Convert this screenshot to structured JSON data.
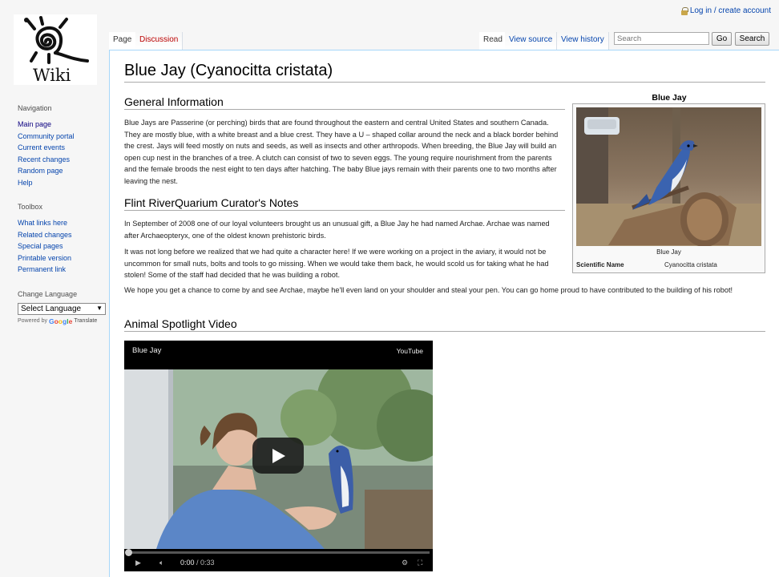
{
  "personal": {
    "login_label": "Log in / create account"
  },
  "logo": {
    "wordmark": "Wiki"
  },
  "sidebar": {
    "navigation": {
      "heading": "Navigation",
      "items": [
        "Main page",
        "Community portal",
        "Current events",
        "Recent changes",
        "Random page",
        "Help"
      ]
    },
    "toolbox": {
      "heading": "Toolbox",
      "items": [
        "What links here",
        "Related changes",
        "Special pages",
        "Printable version",
        "Permanent link"
      ]
    },
    "language": {
      "heading": "Change Language",
      "select_value": "Select Language",
      "powered_by": "Powered by",
      "google_letters": [
        "G",
        "o",
        "o",
        "g",
        "l",
        "e"
      ],
      "translate": "Translate"
    }
  },
  "tabs": {
    "page": "Page",
    "discussion": "Discussion",
    "read": "Read",
    "view_source": "View source",
    "view_history": "View history"
  },
  "search": {
    "placeholder": "Search",
    "go_label": "Go",
    "search_label": "Search"
  },
  "article": {
    "title": "Blue Jay (Cyanocitta cristata)",
    "sections": [
      {
        "heading": "General Information",
        "paragraphs": [
          "Blue Jays are Passerine (or perching) birds that are found throughout the eastern and central United States and southern Canada. They are mostly blue, with a white breast and a blue crest. They have a U – shaped collar around the neck and a black border behind the crest. Jays will feed mostly on nuts and seeds, as well as insects and other arthropods. When breeding, the Blue Jay will build an open cup nest in the branches of a tree. A clutch can consist of two to seven eggs. The young require nourishment from the parents and the female broods the nest eight to ten days after hatching. The baby Blue jays remain with their parents one to two months after leaving the nest."
        ]
      },
      {
        "heading": "Flint RiverQuarium Curator's Notes",
        "paragraphs": [
          "In September of 2008 one of our loyal volunteers brought us an unusual gift, a Blue Jay he had named Archae. Archae was named after Archaeopteryx, one of the oldest known prehistoric birds.",
          "It was not long before we realized that we had quite a character here! If we were working on a project in the aviary, it would not be uncommon for small nuts, bolts and tools to go missing. When we would take them back, he would scold us for taking what he had stolen! Some of the staff had decided that he was building a robot.",
          "We hope you get a chance to come by and see Archae, maybe he'll even land on your shoulder and steal your pen. You can go home proud to have contributed to the building of his robot!"
        ]
      },
      {
        "heading": "Animal Spotlight Video",
        "paragraphs": []
      }
    ]
  },
  "infobox": {
    "title": "Blue Jay",
    "caption": "Blue Jay",
    "rows": [
      {
        "label": "Scientific Name",
        "value": "Cyanocitta cristata"
      }
    ]
  },
  "video": {
    "title": "Blue Jay",
    "provider": "YouTube",
    "time_current": "0:00",
    "time_total": "/ 0:33",
    "progress": 0
  }
}
